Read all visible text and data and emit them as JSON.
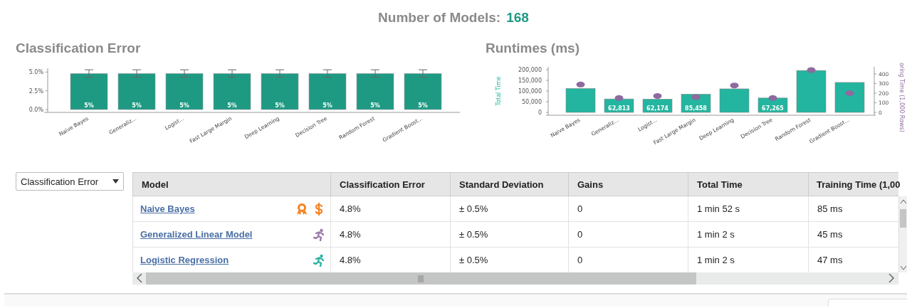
{
  "header": {
    "label": "Number of Models:",
    "value": "168"
  },
  "charts": [
    {
      "chart_data": {
        "type": "bar",
        "title": "Classification Error",
        "categories": [
          "Naive Bayes",
          "Generaliz...",
          "Logist...",
          "Fast Large Margin",
          "Deep Learning",
          "Decision Tree",
          "Random Forest",
          "Gradient Boost..."
        ],
        "series": [
          {
            "color": "#1e9a83",
            "values": [
              4.8,
              4.8,
              4.8,
              4.8,
              4.8,
              4.8,
              4.8,
              4.8
            ]
          }
        ],
        "ylim": [
          0,
          5.5
        ],
        "yticks": [
          {
            "value": 0,
            "label": "0.0%"
          },
          {
            "value": 2.5,
            "label": "2.5%"
          },
          {
            "value": 5,
            "label": "5.0%"
          }
        ],
        "value_labels": [
          "5%",
          "5%",
          "5%",
          "5%",
          "5%",
          "5%",
          "5%",
          "5%"
        ]
      },
      "error_bars": true
    },
    {
      "chart_data": {
        "type": "bar",
        "title": "Runtimes (ms)",
        "categories": [
          "Naive Bayes",
          "Generaliz...",
          "Logist...",
          "Fast Large Margin",
          "Deep Learning",
          "Decision Tree",
          "Random Forest",
          "Gradient Boost..."
        ],
        "series": [
          {
            "name": "Total Time",
            "type": "bar",
            "color": "#23b59f",
            "values": [
              112000,
              62813,
              62174,
              85458,
              110000,
              67265,
              196000,
              140000
            ]
          },
          {
            "name": "oring Time (1,000 Rows)",
            "type": "scatter",
            "axis": "y2",
            "color": "#8e6a9e",
            "values": [
              290,
              150,
              170,
              160,
              280,
              150,
              440,
              200
            ]
          }
        ],
        "ylim": [
          0,
          213000
        ],
        "yticks": [
          {
            "value": 0,
            "label": "0"
          },
          {
            "value": 50000,
            "label": "50,000"
          },
          {
            "value": 100000,
            "label": "100,000"
          },
          {
            "value": 150000,
            "label": "150,000"
          },
          {
            "value": 200000,
            "label": "200,000"
          }
        ],
        "y2lim": [
          0,
          474
        ],
        "y2ticks": [
          {
            "value": 0,
            "label": "0"
          },
          {
            "value": 100,
            "label": "100"
          },
          {
            "value": 200,
            "label": "200"
          },
          {
            "value": 300,
            "label": "300"
          },
          {
            "value": 400,
            "label": "400"
          }
        ],
        "value_labels": [
          null,
          "62,813",
          "62,174",
          "85,458",
          null,
          "67,265",
          null,
          null
        ]
      }
    }
  ],
  "selector": {
    "value": "Classification Error"
  },
  "table": {
    "columns": [
      "Model",
      "Classification Error",
      "Standard Deviation",
      "Gains",
      "Total Time",
      "Training Time (1,00"
    ],
    "rows": [
      {
        "icons": [
          {
            "kind": "award",
            "color": "#f58220"
          },
          {
            "kind": "dollar",
            "color": "#f58220"
          }
        ],
        "cells": [
          "Naive Bayes",
          "4.8%",
          "± 0.5%",
          "0",
          "1 min 52 s",
          "85 ms"
        ]
      },
      {
        "icons": [
          {
            "kind": "runner",
            "color": "#9b7aa9"
          }
        ],
        "cells": [
          "Generalized Linear Model",
          "4.8%",
          "± 0.5%",
          "0",
          "1 min 2 s",
          "45 ms"
        ]
      },
      {
        "icons": [
          {
            "kind": "runner",
            "color": "#2bb3a3"
          }
        ],
        "cells": [
          "Logistic Regression",
          "4.8%",
          "± 0.5%",
          "0",
          "1 min 2 s",
          "47 ms"
        ]
      }
    ]
  }
}
